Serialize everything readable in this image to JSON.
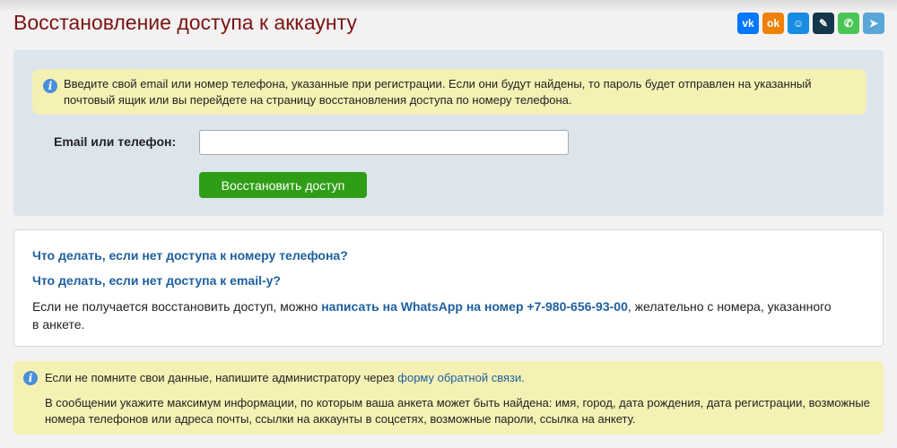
{
  "page": {
    "title": "Восстановление доступа к аккаунту"
  },
  "share": {
    "buttons": [
      {
        "name": "vk",
        "glyph": "vk",
        "color": "#0077ff"
      },
      {
        "name": "odnoklassniki",
        "glyph": "ok",
        "color": "#ee8208"
      },
      {
        "name": "moi-mir",
        "glyph": "☺",
        "color": "#168de2"
      },
      {
        "name": "livejournal",
        "glyph": "✎",
        "color": "#15374c"
      },
      {
        "name": "whatsapp",
        "glyph": "✆",
        "color": "#4ac656"
      },
      {
        "name": "telegram",
        "glyph": "➤",
        "color": "#5aa6d8"
      }
    ]
  },
  "form": {
    "info": "Введите свой email или номер телефона, указанные при регистрации. Если они будут найдены, то пароль будет отправлен на указанный почтовый ящик или вы перейдете на страницу восстановления доступа по номеру телефона.",
    "field_label": "Email или телефон:",
    "field_value": "",
    "submit_label": "Восстановить доступ"
  },
  "help": {
    "link_phone": "Что делать, если нет доступа к номеру телефона?",
    "link_email": "Что делать, если нет доступа к email-у?",
    "text_before": "Если не получается восстановить доступ, можно ",
    "whatsapp_link": "написать на WhatsApp на номер +7-980-656-93-00",
    "text_after": ", желательно с номера, указанного в анкете."
  },
  "note": {
    "text_before": "Если не помните свои данные, напишите администратору через ",
    "feedback_link": "форму обратной связи.",
    "details": "В сообщении укажите максимум информации, по которым ваша анкета может быть найдена: имя, город, дата рождения, дата регистрации, возможные номера телефонов или адреса почты, ссылки на аккаунты в соцсетях, возможные пароли, ссылка на анкету."
  }
}
